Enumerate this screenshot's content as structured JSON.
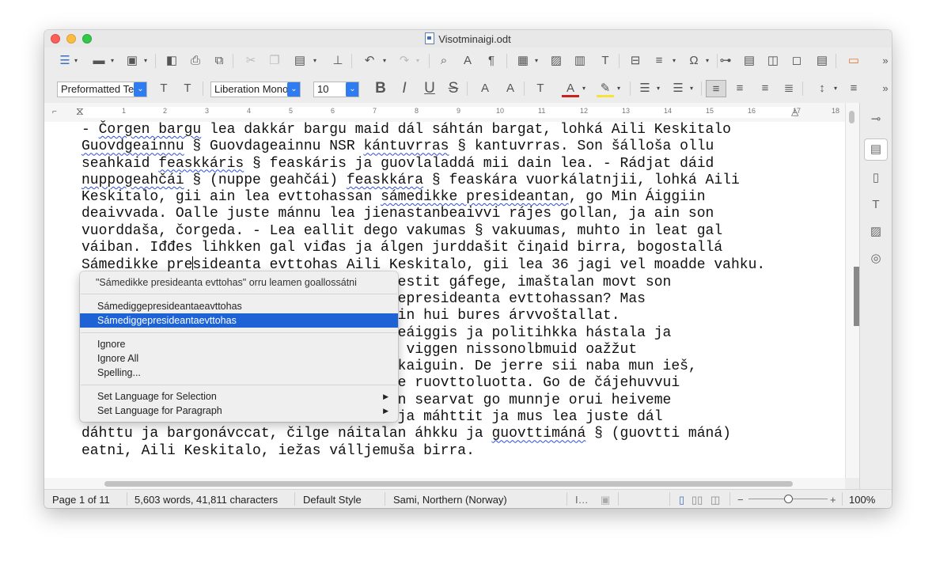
{
  "window": {
    "title": "Visotminaigi.odt"
  },
  "toolbar1": {
    "icons": [
      "sidebar-toggle-icon",
      "open-folder-icon",
      "save-icon",
      "export-pdf-icon",
      "print-icon",
      "print-preview-icon",
      "cut-icon",
      "copy-icon",
      "paste-icon",
      "clone-formatting-icon",
      "undo-icon",
      "redo-icon",
      "find-replace-icon",
      "spelling-icon",
      "formatting-marks-icon",
      "table-icon",
      "image-icon",
      "chart-icon",
      "textbox-icon",
      "page-break-icon",
      "field-icon",
      "special-character-icon",
      "hyperlink-icon",
      "footnote-icon",
      "endnote-icon",
      "bookmark-icon",
      "cross-reference-icon",
      "comment-icon"
    ],
    "overflow": "»"
  },
  "toolbar2": {
    "paragraph_style": "Preformatted Te",
    "font_name": "Liberation Mono",
    "font_size": "10",
    "bold": "B",
    "italic": "I",
    "underline": "U",
    "strikethrough": "S",
    "overflow": "»"
  },
  "ruler": {
    "numbers": [
      "1",
      "2",
      "3",
      "4",
      "5",
      "6",
      "7",
      "8",
      "9",
      "10",
      "11",
      "12",
      "13",
      "14",
      "15",
      "16",
      "17",
      "18"
    ]
  },
  "document": {
    "lines": [
      [
        "- ",
        {
          "sq": "Čorgen bargu"
        },
        " lea dakkár bargu maid dál sáhtán bargat, lohká Aili Keskitalo"
      ],
      [
        {
          "sq": "Guovdgeainnu"
        },
        " § Guovdageainnu NSR ",
        {
          "sq": "kántuvrras"
        },
        " § kantuvrras. Son šálloša ollu"
      ],
      [
        "seahkaid ",
        {
          "sq": "feaskkáris"
        },
        " § feaskáris ja guovlaladdá mii dain lea. - Rádjat dáid"
      ],
      [
        {
          "sq": "nuppogeahčái"
        },
        " § (nuppe geahčái) ",
        {
          "sq": "feaskkára"
        },
        " § feaskára vuorkálatnjii, lohká Aili"
      ],
      [
        "Keskitalo, gii ain lea evttohassan ",
        {
          "sq": "sámedikke presideantan"
        },
        ", go Min Áiggiin"
      ],
      [
        "deaivvada. Oalle juste mánnu lea jienastanbeaivvi rájes gollan, ja ain son"
      ],
      [
        "vuorddaša, čorgeda. - Lea eallit dego vakumas § vakuumas, muhto in leat gal"
      ],
      [
        "váiban. Iđđes lihkken gal viđas ja álgen jurddašit čiŋaid birra, bogostallá"
      ],
      [
        {
          "sq": "Sámedikke presideanta evttohas"
        },
        " Aili Keskitalo, gii lea 36 jagi vel moadde vahku."
      ],
      [
        "                           rgan njorrestit gáfege, imaštalan movt son"
      ],
      [
        "                           § sámediggepresideanta evttohassan? Mas"
      ],
      [
        "                           dan fertejin hui bures árvvoštallat."
      ],
      [
        "                           nga boahtteáiggis ja politihkka hástala ja"
      ],
      [
        "                           egottis ja viggen nissonolbmuid oažžut"
      ],
      [
        "                           riiguin ákkaiguin. De jerre sii naba mun ieš,"
      ],
      [
        "                           ohte munnje ruovttoluotta. Go de čájehuvvui"
      ],
      [
        "                           de vállejin searvat go munnje orui heiveme"
      ],
      [
        "                           d sáhttit ja máhttit ja mus lea juste dál"
      ],
      [
        "dáhttu ja bargonávccat, čilge náitalan áhkku ja ",
        {
          "sq": "guovttimáná"
        },
        " § (guovtti máná)"
      ],
      [
        "eatni, Aili Keskitalo, iežas válljemuša birra."
      ]
    ]
  },
  "context_menu": {
    "header": "\"Sámedikke presideanta evttohas\" orru leamen goallossátni",
    "suggestions": [
      "Sámediggepresideantaeavttohas",
      "Sámediggepresideantaevttohas"
    ],
    "ignore": "Ignore",
    "ignore_all": "Ignore All",
    "spelling": "Spelling...",
    "set_language_selection": "Set Language for Selection",
    "set_language_paragraph": "Set Language for Paragraph",
    "submenu_arrow": "▶"
  },
  "statusbar": {
    "page": "Page 1 of 11",
    "words": "5,603 words, 41,811 characters",
    "style": "Default Style",
    "language": "Sami, Northern (Norway)",
    "zoom_minus": "−",
    "zoom_plus": "+",
    "zoom": "100%"
  }
}
